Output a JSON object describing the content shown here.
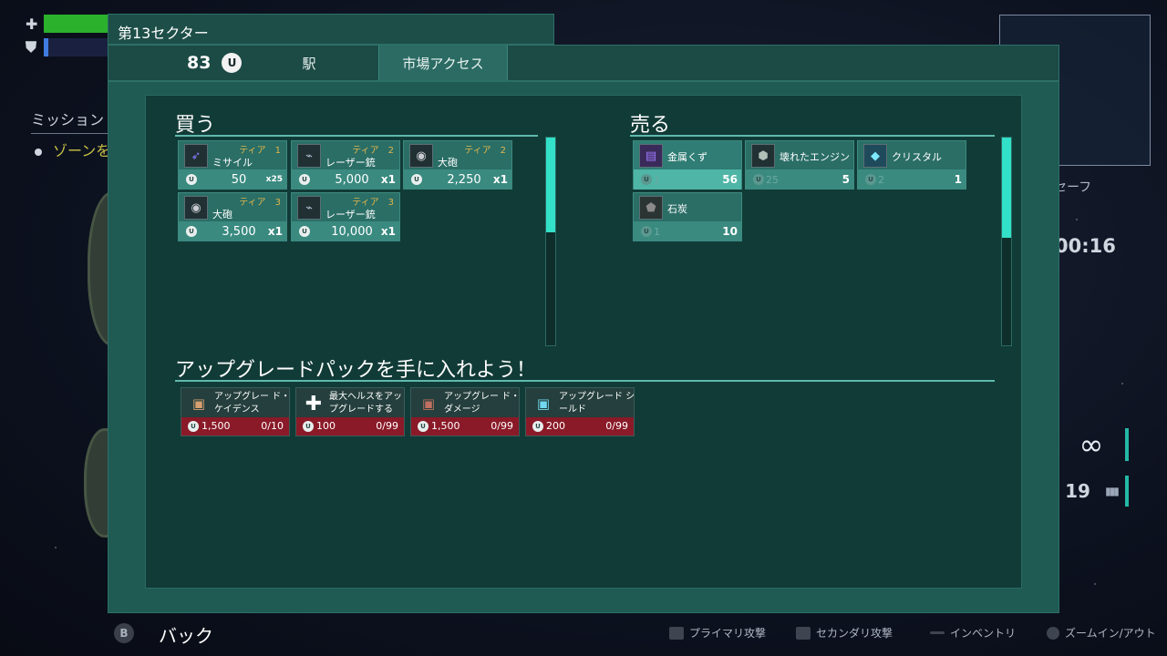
{
  "hud": {
    "health_icon": "plus-icon",
    "shield_icon": "shield-icon",
    "mission_title": "ミッション",
    "mission_item": "ゾーンを探検",
    "safe_label": "セーフ",
    "timer": "00:16",
    "infinite_ammo": "∞",
    "ammo_count": "19"
  },
  "header": {
    "sector": "第13セクター",
    "credits": "83",
    "currency_symbol": "U",
    "tabs": [
      {
        "label": "駅",
        "active": false
      },
      {
        "label": "市場アクセス",
        "active": true
      }
    ]
  },
  "buy": {
    "title": "買う",
    "items": [
      {
        "name": "ミサイル",
        "tier": "ティア　1",
        "price": "50",
        "qty": "x25",
        "icon": "missile-icon"
      },
      {
        "name": "レーザー銃",
        "tier": "ティア　2",
        "price": "5,000",
        "qty": "x1",
        "icon": "laser-gun-icon"
      },
      {
        "name": "大砲",
        "tier": "ティア　2",
        "price": "2,250",
        "qty": "x1",
        "icon": "cannon-icon"
      },
      {
        "name": "大砲",
        "tier": "ティア　3",
        "price": "3,500",
        "qty": "x1",
        "icon": "cannon-icon"
      },
      {
        "name": "レーザー銃",
        "tier": "ティア　3",
        "price": "10,000",
        "qty": "x1",
        "icon": "laser-gun-icon"
      }
    ]
  },
  "sell": {
    "title": "売る",
    "items": [
      {
        "name": "金属くず",
        "price": "1",
        "qty": "56",
        "icon": "scrap-metal-icon",
        "selected": true
      },
      {
        "name": "壊れたエンジン",
        "price": "25",
        "qty": "5",
        "icon": "broken-engine-icon",
        "selected": false
      },
      {
        "name": "クリスタル",
        "price": "2",
        "qty": "1",
        "icon": "crystal-icon",
        "selected": false
      },
      {
        "name": "石炭",
        "price": "1",
        "qty": "10",
        "icon": "coal-icon",
        "selected": false
      }
    ]
  },
  "upgrades": {
    "title": "アップグレードパックを手に入れよう！",
    "items": [
      {
        "name": "アップグレー ド・ケイデンス",
        "price": "1,500",
        "count": "0/10",
        "icon": "cadence-upgrade-icon"
      },
      {
        "name": "最大ヘルスをアップグレードする",
        "price": "100",
        "count": "0/99",
        "icon": "health-upgrade-icon"
      },
      {
        "name": "アップグレー ド・ダメージ",
        "price": "1,500",
        "count": "0/99",
        "icon": "damage-upgrade-icon"
      },
      {
        "name": "アップグレード シールド",
        "price": "200",
        "count": "0/99",
        "icon": "shield-upgrade-icon"
      }
    ]
  },
  "footer": {
    "back_button": "B",
    "back_label": "バック",
    "controls": [
      {
        "label": "プライマリ攻撃",
        "icon": "trigger-icon"
      },
      {
        "label": "セカンダリ攻撃",
        "icon": "trigger-icon"
      },
      {
        "label": "インベントリ",
        "icon": "menu-icon"
      },
      {
        "label": "ズームイン/アウト",
        "icon": "stick-icon"
      }
    ]
  },
  "colors": {
    "accent": "#33e0c8",
    "panel": "#113b37",
    "upgrade_price_bar": "#8a1a28",
    "tier_text": "#e2b54a"
  }
}
